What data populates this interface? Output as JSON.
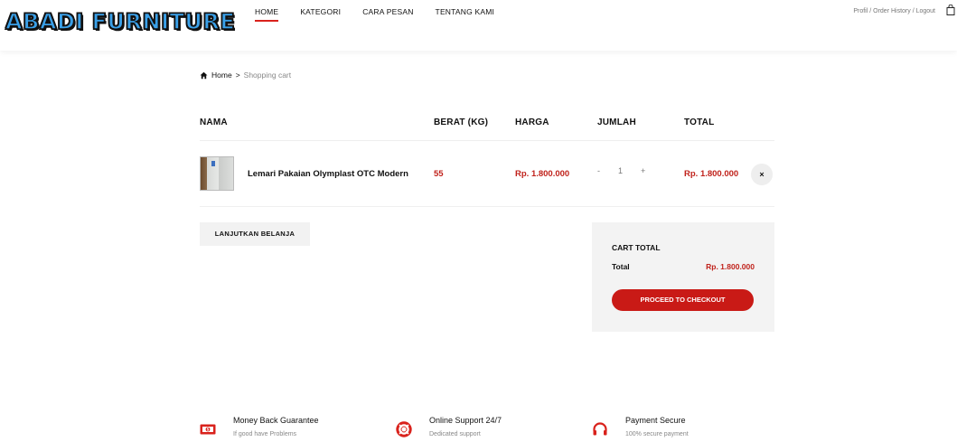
{
  "brand": {
    "logo_text": "ABADI FURNITURE",
    "accent": "#c91a16",
    "price_color": "#c0221b"
  },
  "nav": {
    "items": [
      {
        "label": "HOME",
        "active": true
      },
      {
        "label": "KATEGORI",
        "active": false
      },
      {
        "label": "CARA PESAN",
        "active": false
      },
      {
        "label": "TENTANG KAMI",
        "active": false
      }
    ],
    "account_links": "Profil / Order History / Logout",
    "cart_icon": "shopping-bag-icon"
  },
  "breadcrumb": {
    "home": "Home",
    "separator": ">",
    "current": "Shopping cart"
  },
  "cart": {
    "columns": {
      "name": "NAMA",
      "weight": "BERAT (KG)",
      "price": "HARGA",
      "qty": "JUMLAH",
      "total": "TOTAL"
    },
    "items": [
      {
        "name": "Lemari Pakaian Olymplast OTC Modern",
        "weight": "55",
        "price": "Rp. 1.800.000",
        "qty_decrease": "-",
        "qty": "1",
        "qty_increase": "+",
        "total": "Rp. 1.800.000",
        "remove": "×"
      }
    ]
  },
  "actions": {
    "continue_shopping": "LANJUTKAN BELANJA"
  },
  "cart_total": {
    "title": "CART TOTAL",
    "total_label": "Total",
    "total_value": "Rp. 1.800.000",
    "checkout": "PROCEED TO CHECKOUT"
  },
  "features": [
    {
      "icon": "money-icon",
      "title": "Money Back Guarantee",
      "subtitle": "If good have Problems"
    },
    {
      "icon": "lifebuoy-icon",
      "title": "Online Support 24/7",
      "subtitle": "Dedicated support"
    },
    {
      "icon": "headphones-icon",
      "title": "Payment Secure",
      "subtitle": "100% secure payment"
    }
  ]
}
